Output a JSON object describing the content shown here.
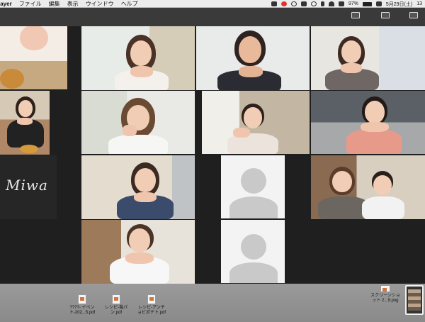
{
  "menubar": {
    "app_name": "layer",
    "items": [
      "ファイル",
      "編集",
      "表示",
      "ウインドウ",
      "ヘルプ"
    ],
    "battery": "97%",
    "battery_level": 0.97,
    "date": "5月29日(土)",
    "time": "13"
  },
  "grid": {
    "name_tile_text": "Miwa"
  },
  "desktop": {
    "files": [
      {
        "name_line1": "????- イベン",
        "name_line2": "ト-202...5.pdf"
      },
      {
        "name_line1": "レシピ-塩パ",
        "name_line2": "ン.pdf"
      },
      {
        "name_line1": "レシピ-アンチ",
        "name_line2": "ョビポテト.pdf"
      }
    ],
    "screenshot_file": {
      "name_line1": "スクリーンショ",
      "name_line2": "ット 2...9.png"
    }
  },
  "colors": {
    "menubar_bg": "#ececec",
    "grid_bg": "#1f1f1f",
    "placeholder": "#c9c9c9"
  }
}
